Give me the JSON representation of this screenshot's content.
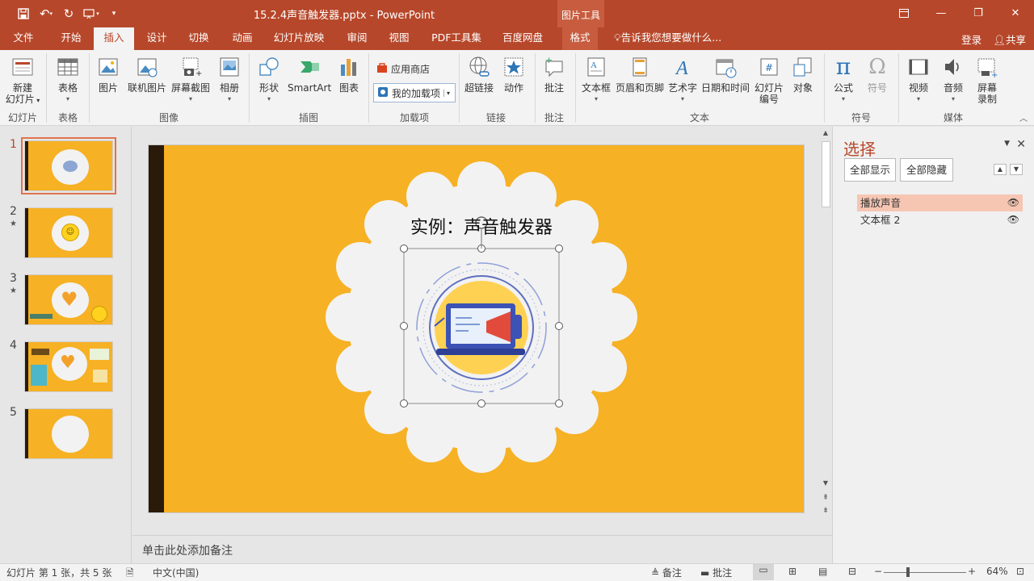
{
  "titlebar": {
    "title": "15.2.4声音触发器.pptx - PowerPoint",
    "context_tab": "图片工具",
    "window_controls": [
      "ribbon-display-icon",
      "minimize-icon",
      "restore-icon",
      "close-icon"
    ]
  },
  "tabs": [
    "文件",
    "开始",
    "插入",
    "设计",
    "切换",
    "动画",
    "幻灯片放映",
    "审阅",
    "视图",
    "PDF工具集",
    "百度网盘",
    "格式"
  ],
  "active_tab": "插入",
  "tell_me": "告诉我您想要做什么...",
  "login": "登录",
  "share": "共享",
  "ribbon": {
    "new_slide": "新建",
    "new_slide2": "幻灯片",
    "table": "表格",
    "picture": "图片",
    "online_picture": "联机图片",
    "screenshot": "屏幕截图",
    "album": "相册",
    "shapes": "形状",
    "smartart": "SmartArt",
    "chart": "图表",
    "store": "应用商店",
    "my_addins": "我的加载项",
    "hyperlink": "超链接",
    "action": "动作",
    "comment": "批注",
    "textbox": "文本框",
    "header_footer": "页眉和页脚",
    "wordart": "艺术字",
    "datetime": "日期和时间",
    "slide_number1": "幻灯片",
    "slide_number2": "编号",
    "object": "对象",
    "equation": "公式",
    "symbol": "符号",
    "video": "视频",
    "audio": "音频",
    "screen_rec1": "屏幕",
    "screen_rec2": "录制",
    "groups": {
      "slides": "幻灯片",
      "tables": "表格",
      "images": "图像",
      "illustrations": "插图",
      "addins": "加载项",
      "links": "链接",
      "comments": "批注",
      "text": "文本",
      "symbols": "符号",
      "media": "媒体"
    }
  },
  "slides": {
    "numbers": [
      "1",
      "2",
      "3",
      "4",
      "5"
    ],
    "active": 1
  },
  "slide": {
    "title": "实例：声音触发器"
  },
  "notes_placeholder": "单击此处添加备注",
  "selection_pane": {
    "title": "选择",
    "show_all": "全部显示",
    "hide_all": "全部隐藏",
    "items": [
      "播放声音",
      "文本框 2"
    ],
    "selected": "播放声音"
  },
  "status": {
    "slide_info": "幻灯片 第 1 张，共 5 张",
    "language": "中文(中国)",
    "notes": "备注",
    "comments": "批注",
    "zoom": "64%"
  },
  "colors": {
    "brand": "#b7472a",
    "slide_bg": "#f6b124",
    "slide_bar": "#2a1a0a"
  }
}
